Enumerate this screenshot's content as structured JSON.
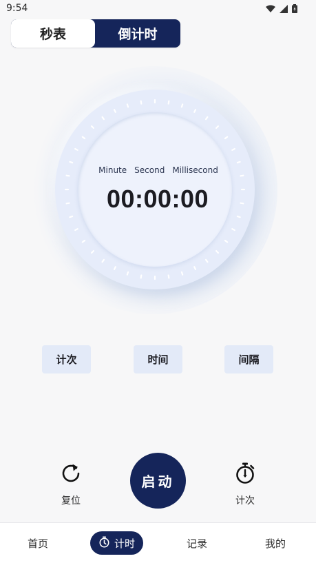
{
  "status_bar": {
    "time": "9:54",
    "icons": [
      "wifi-icon",
      "signal-icon",
      "battery-icon"
    ]
  },
  "mode_toggle": {
    "stopwatch": "秒表",
    "countdown": "倒计时",
    "active": "stopwatch"
  },
  "dial": {
    "unit_minute": "Minute",
    "unit_second": "Second",
    "unit_millisecond": "Millisecond",
    "readout": "00:00:00"
  },
  "options": {
    "count": "计次",
    "time": "时间",
    "interval": "间隔"
  },
  "controls": {
    "reset_label": "复位",
    "start_label": "启动",
    "lap_label": "计次"
  },
  "bottom_nav": {
    "home": "首页",
    "timer": "计时",
    "records": "记录",
    "mine": "我的",
    "active": "timer"
  },
  "colors": {
    "accent": "#15255a",
    "pill_bg": "#e3eaf8",
    "dial_bg": "#e6ecfa"
  }
}
